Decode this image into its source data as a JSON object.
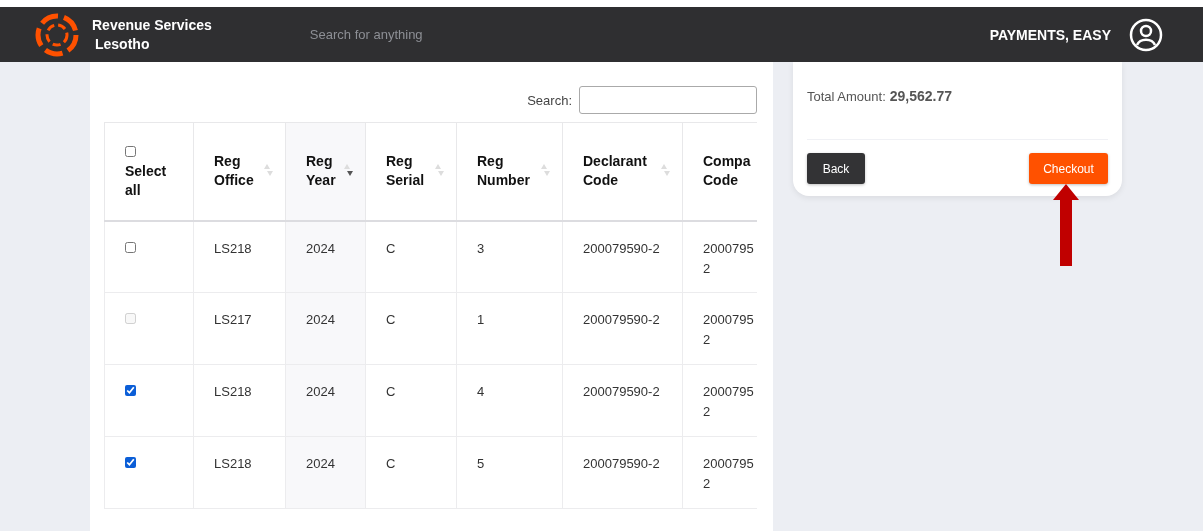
{
  "header": {
    "brand_line_1": "Revenue Services",
    "brand_line_2": "Lesotho",
    "search": {
      "placeholder": "Search for anything"
    },
    "tagline": "PAYMENTS, EASY"
  },
  "table": {
    "search_label": "Search:",
    "select_all": {
      "label": "Select all",
      "checked": false
    },
    "columns": [
      {
        "label": "Reg Office",
        "sorted": false
      },
      {
        "label": "Reg Year",
        "sorted": true
      },
      {
        "label": "Reg Serial",
        "sorted": false
      },
      {
        "label": "Reg Number",
        "sorted": false
      },
      {
        "label": "Declarant Code",
        "sorted": false
      },
      {
        "label": "Compa Code"
      }
    ],
    "rows": [
      {
        "checked": false,
        "disabled": false,
        "cells": [
          "LS218",
          "2024",
          "C",
          "3",
          "200079590-2",
          "2000795\n2"
        ]
      },
      {
        "checked": false,
        "disabled": true,
        "cells": [
          "LS217",
          "2024",
          "C",
          "1",
          "200079590-2",
          "2000795\n2"
        ]
      },
      {
        "checked": true,
        "disabled": false,
        "cells": [
          "LS218",
          "2024",
          "C",
          "4",
          "200079590-2",
          "2000795\n2"
        ]
      },
      {
        "checked": true,
        "disabled": false,
        "cells": [
          "LS218",
          "2024",
          "C",
          "5",
          "200079590-2",
          "2000795\n2"
        ]
      }
    ]
  },
  "summary": {
    "total_label": "Total Amount:",
    "total_value": "29,562.77",
    "buttons": [
      {
        "label": "Back",
        "kind": "secondary"
      },
      {
        "label": "Checkout",
        "kind": "primary"
      }
    ]
  }
}
